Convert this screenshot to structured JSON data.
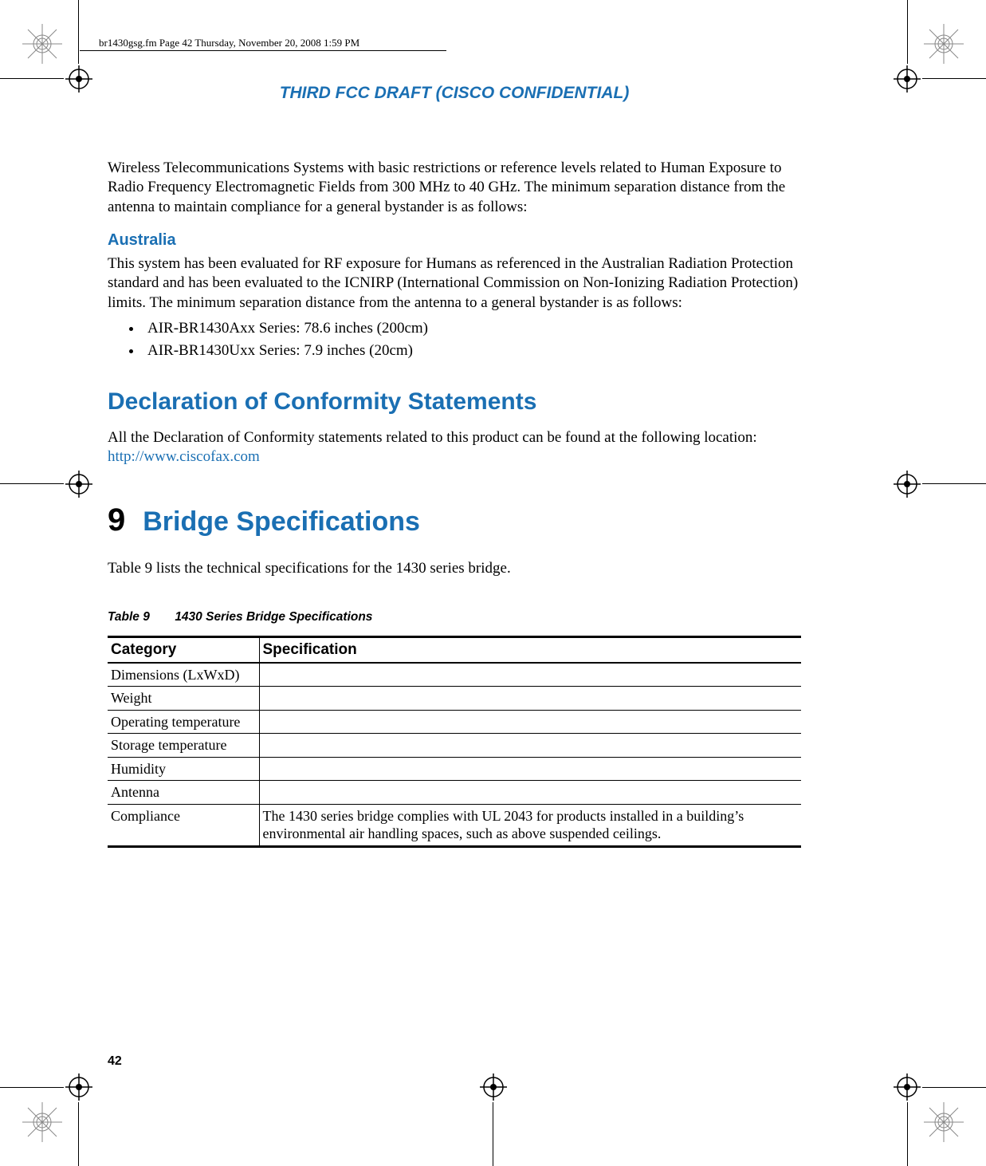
{
  "header_path": "br1430gsg.fm  Page 42  Thursday, November 20, 2008  1:59 PM",
  "draft_banner": "THIRD FCC DRAFT (CISCO CONFIDENTIAL)",
  "intro_para": "Wireless Telecommunications Systems with basic restrictions or reference levels related to Human Exposure to Radio Frequency Electromagnetic Fields from 300 MHz to 40 GHz. The minimum separation distance from the antenna to maintain compliance for a general bystander is as follows:",
  "australia": {
    "heading": "Australia",
    "para": "This system has been evaluated for RF exposure for Humans as referenced in the Australian Radiation Protection standard and has been evaluated to the ICNIRP (International Commission on Non-Ionizing Radiation Protection) limits. The minimum separation distance from the antenna to a general bystander is as follows:",
    "bullets": [
      "AIR-BR1430Axx Series: 78.6 inches (200cm)",
      "AIR-BR1430Uxx Series: 7.9 inches (20cm)"
    ]
  },
  "doc": {
    "heading": "Declaration of Conformity Statements",
    "para_pre": "All the Declaration of Conformity statements related to this product can be found at the following location: ",
    "link": "http://www.ciscofax.com"
  },
  "chapter": {
    "num": "9",
    "title": "Bridge Specifications",
    "lead": "Table 9 lists the technical specifications for the 1430 series bridge."
  },
  "table": {
    "label": "Table 9",
    "caption": "1430 Series Bridge Specifications",
    "head": {
      "c1": "Category",
      "c2": "Specification"
    },
    "rows": [
      {
        "c1": "Dimensions (LxWxD)",
        "c2": ""
      },
      {
        "c1": "Weight",
        "c2": ""
      },
      {
        "c1": "Operating temperature",
        "c2": ""
      },
      {
        "c1": "Storage temperature",
        "c2": ""
      },
      {
        "c1": "Humidity",
        "c2": ""
      },
      {
        "c1": "Antenna",
        "c2": ""
      },
      {
        "c1": "Compliance",
        "c2": "The 1430 series bridge complies with UL 2043 for products installed in a building’s environmental air handling spaces, such as above suspended ceilings."
      }
    ]
  },
  "page_number": "42"
}
